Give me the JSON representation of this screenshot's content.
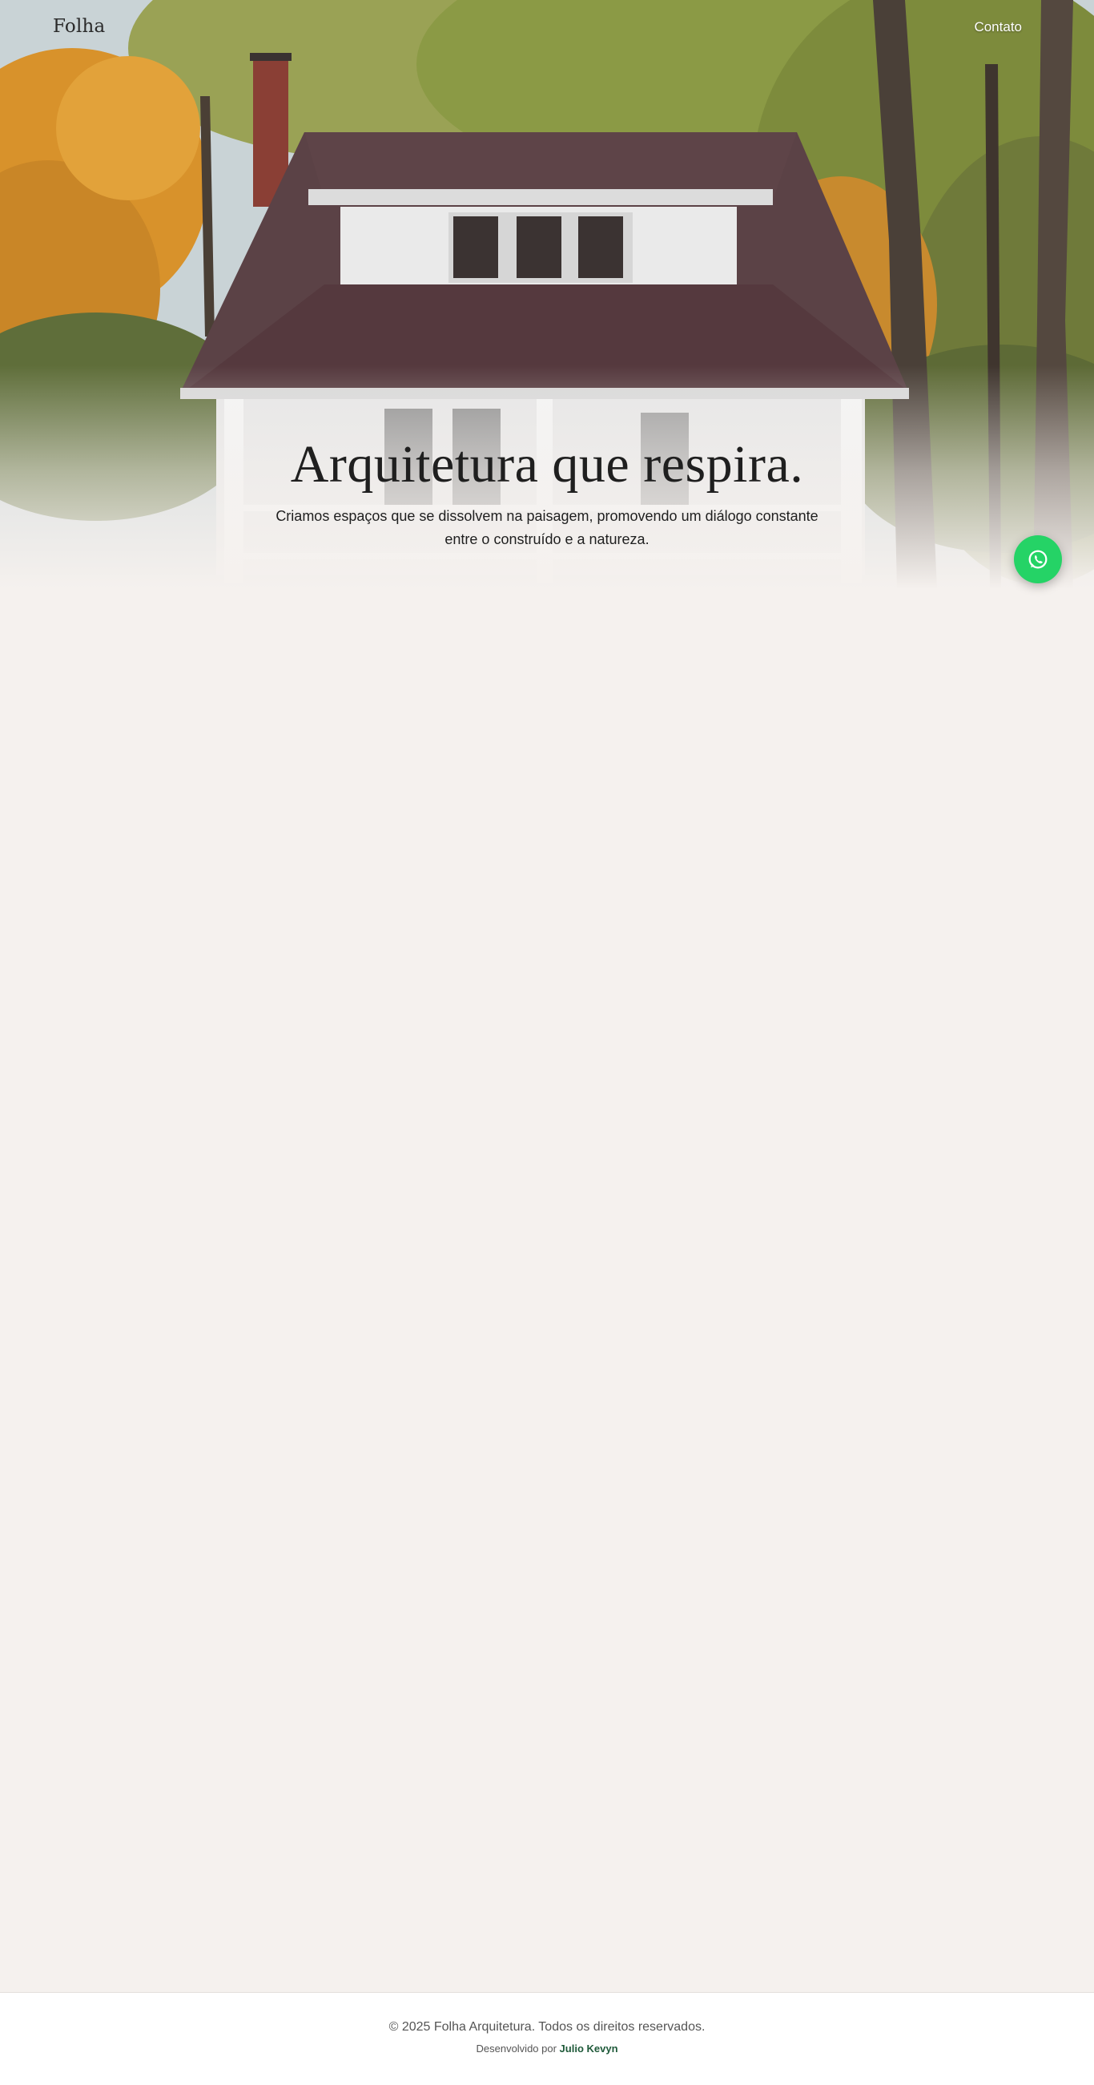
{
  "header": {
    "brand": "Folha",
    "nav_contact": "Contato"
  },
  "hero": {
    "title": "Arquitetura que respira.",
    "subtitle": "Criamos espaços que se dissolvem na paisagem, promovendo um diálogo constante entre o construído e a natureza.",
    "image": "house-with-autumn-trees"
  },
  "floating": {
    "whatsapp_icon": "whatsapp-icon",
    "color": "#25d366"
  },
  "footer": {
    "copyright": "© 2025 Folha Arquitetura. Todos os direitos reservados.",
    "developed_by_prefix": "Desenvolvido por",
    "developer_name": "Julio Kevyn"
  },
  "colors": {
    "page_background": "#f5f1ee",
    "footer_background": "#ffffff",
    "accent_link": "#1f5a3a"
  }
}
